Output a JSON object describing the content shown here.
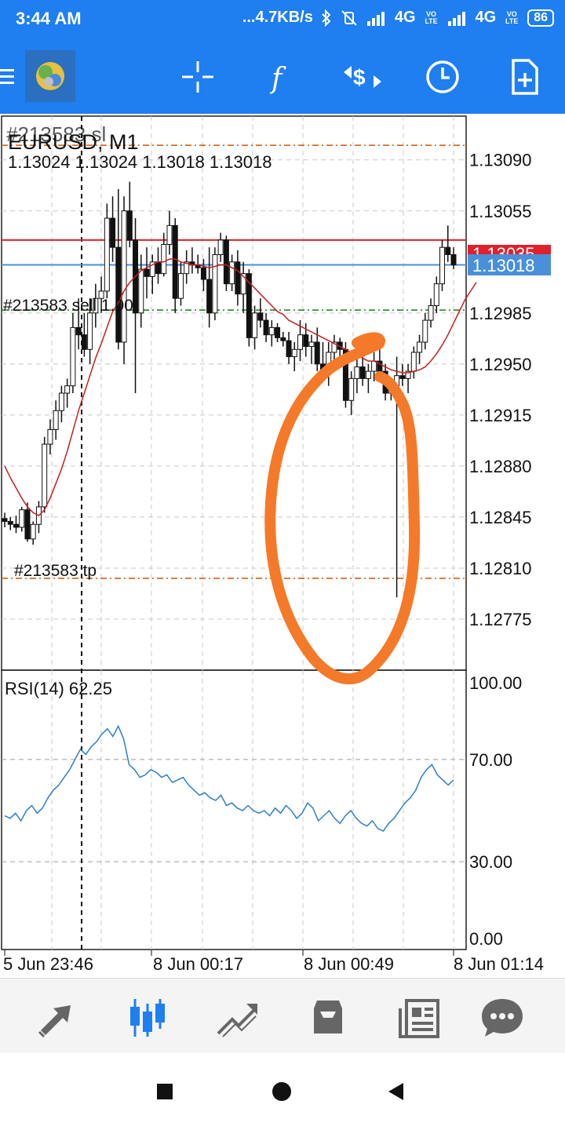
{
  "status_bar": {
    "time": "3:44 AM",
    "net_speed": "...4.7KB/s",
    "signal_1": "4G",
    "signal_2": "4G",
    "volte": "VO LTE",
    "battery": "86",
    "icons": [
      "bluetooth-icon",
      "mute-vibrate-icon",
      "signal-icon",
      "battery-icon"
    ]
  },
  "toolbar": {
    "app_icon": "metatrader-logo-icon",
    "actions": [
      "menu-icon",
      "crosshair-icon",
      "indicators-icon",
      "trade-icon",
      "timeframe-clock-icon",
      "new-order-icon"
    ],
    "indicators_glyph": "f"
  },
  "chart": {
    "symbol": "EURUSD, M1",
    "ohlc": "1.13024 1.13024 1.13018 1.13018",
    "bid": "1.13018",
    "ask": "1.13035",
    "order_sl_label": "#213583 sl",
    "order_open_label": "#213583 sell 1.00",
    "order_tp_label": "#213583 tp",
    "price_ticks": [
      "1.13090",
      "1.13055",
      "1.12985",
      "1.12950",
      "1.12915",
      "1.12880",
      "1.12845",
      "1.12810",
      "1.12775"
    ],
    "rsi_label": "RSI(14) 62.25",
    "rsi_ticks": [
      "100.00",
      "70.00",
      "30.00",
      "0.00"
    ],
    "time_labels": [
      "5 Jun 23:46",
      "8 Jun 00:17",
      "8 Jun 00:49",
      "8 Jun 01:14"
    ],
    "colors": {
      "bid_line": "#4a90d9",
      "ask_line": "#e0202a",
      "ma_line": "#c81e1e",
      "rsi_line": "#2d7fc4",
      "sl_tp_line": "#d35400",
      "open_line": "#1a7a1a",
      "annotation": "#f47a2a"
    },
    "note_annotation": "orange hand-drawn circle around long downward wick near 8 Jun 00:49"
  },
  "chart_data": {
    "type": "candlestick",
    "title": "EURUSD, M1",
    "x": [
      "5 Jun 23:46",
      "8 Jun 00:17",
      "8 Jun 00:49",
      "8 Jun 01:14"
    ],
    "ylim": [
      1.1274,
      1.1312
    ],
    "order_levels": {
      "sl": 1.131,
      "open": 1.12987,
      "tp": 1.12803
    },
    "current": {
      "bid": 1.13018,
      "ask": 1.13035
    },
    "last_bar_ohlc": [
      1.13024,
      1.13024,
      1.13018,
      1.13018
    ],
    "candles": [
      [
        1.12844,
        1.12848,
        1.12838,
        1.12842
      ],
      [
        1.12842,
        1.12845,
        1.12836,
        1.1284
      ],
      [
        1.1284,
        1.12846,
        1.12834,
        1.12838
      ],
      [
        1.12838,
        1.12852,
        1.12835,
        1.1285
      ],
      [
        1.1285,
        1.12855,
        1.12828,
        1.1283
      ],
      [
        1.1283,
        1.12842,
        1.12826,
        1.1284
      ],
      [
        1.1284,
        1.12856,
        1.12834,
        1.12852
      ],
      [
        1.12852,
        1.129,
        1.12848,
        1.12895
      ],
      [
        1.12895,
        1.12912,
        1.12888,
        1.12905
      ],
      [
        1.12905,
        1.12925,
        1.12898,
        1.12918
      ],
      [
        1.12918,
        1.12935,
        1.1291,
        1.1293
      ],
      [
        1.1293,
        1.1294,
        1.1292,
        1.12935
      ],
      [
        1.12935,
        1.12985,
        1.1293,
        1.12975
      ],
      [
        1.12975,
        1.12995,
        1.1296,
        1.1297
      ],
      [
        1.1297,
        1.12985,
        1.12955,
        1.1296
      ],
      [
        1.1296,
        1.12995,
        1.1295,
        1.12985
      ],
      [
        1.12985,
        1.13005,
        1.12975,
        1.12995
      ],
      [
        1.12995,
        1.1301,
        1.12985,
        1.13
      ],
      [
        1.13,
        1.1306,
        1.12995,
        1.1305
      ],
      [
        1.1305,
        1.13065,
        1.1302,
        1.1303
      ],
      [
        1.1303,
        1.1307,
        1.1296,
        1.12965
      ],
      [
        1.12965,
        1.13065,
        1.1295,
        1.13055
      ],
      [
        1.13055,
        1.13075,
        1.1303,
        1.13035
      ],
      [
        1.13035,
        1.1305,
        1.1293,
        1.12985
      ],
      [
        1.12985,
        1.13025,
        1.12975,
        1.13015
      ],
      [
        1.13015,
        1.1303,
        1.12995,
        1.1301
      ],
      [
        1.1301,
        1.13025,
        1.12998,
        1.1302
      ],
      [
        1.1302,
        1.1303,
        1.13005,
        1.13012
      ],
      [
        1.13012,
        1.1304,
        1.1301,
        1.13032
      ],
      [
        1.13032,
        1.13055,
        1.13025,
        1.13045
      ],
      [
        1.13045,
        1.1305,
        1.12985,
        1.12995
      ],
      [
        1.12995,
        1.1302,
        1.1299,
        1.13012
      ],
      [
        1.13012,
        1.13028,
        1.13005,
        1.1302
      ],
      [
        1.1302,
        1.1303,
        1.13012,
        1.13018
      ],
      [
        1.13018,
        1.13025,
        1.13012,
        1.13016
      ],
      [
        1.13016,
        1.13022,
        1.13,
        1.13008
      ],
      [
        1.13008,
        1.1303,
        1.12975,
        1.12985
      ],
      [
        1.12985,
        1.1303,
        1.1298,
        1.13025
      ],
      [
        1.13025,
        1.1304,
        1.1302,
        1.13035
      ],
      [
        1.13035,
        1.13038,
        1.13,
        1.13005
      ],
      [
        1.13005,
        1.13025,
        1.13,
        1.1302
      ],
      [
        1.1302,
        1.13028,
        1.1299,
        1.12998
      ],
      [
        1.12998,
        1.1302,
        1.12985,
        1.13012
      ],
      [
        1.13012,
        1.13015,
        1.12962,
        1.12968
      ],
      [
        1.12968,
        1.1299,
        1.1296,
        1.12985
      ],
      [
        1.12985,
        1.12995,
        1.12975,
        1.1298
      ],
      [
        1.1298,
        1.12985,
        1.12965,
        1.1297
      ],
      [
        1.1297,
        1.1298,
        1.12962,
        1.12975
      ],
      [
        1.12975,
        1.12978,
        1.12965,
        1.12968
      ],
      [
        1.12968,
        1.12972,
        1.12962,
        1.12966
      ],
      [
        1.12966,
        1.12972,
        1.1295,
        1.12955
      ],
      [
        1.12955,
        1.12965,
        1.12945,
        1.1296
      ],
      [
        1.1296,
        1.1298,
        1.12952,
        1.1297
      ],
      [
        1.1297,
        1.12978,
        1.12955,
        1.12962
      ],
      [
        1.12962,
        1.1297,
        1.1295,
        1.12965
      ],
      [
        1.12965,
        1.12975,
        1.12945,
        1.1295
      ],
      [
        1.1295,
        1.12965,
        1.1294,
        1.12945
      ],
      [
        1.12945,
        1.12965,
        1.12935,
        1.12958
      ],
      [
        1.12958,
        1.1297,
        1.1295,
        1.12965
      ],
      [
        1.12965,
        1.12968,
        1.12955,
        1.1296
      ],
      [
        1.1296,
        1.12965,
        1.1292,
        1.12925
      ],
      [
        1.12925,
        1.12945,
        1.12915,
        1.1294
      ],
      [
        1.1294,
        1.12955,
        1.1293,
        1.12948
      ],
      [
        1.12948,
        1.12955,
        1.12935,
        1.1294
      ],
      [
        1.1294,
        1.1295,
        1.1293,
        1.12945
      ],
      [
        1.12945,
        1.12958,
        1.12938,
        1.12952
      ],
      [
        1.12952,
        1.1296,
        1.1294,
        1.12945
      ],
      [
        1.12945,
        1.1295,
        1.12925,
        1.1293
      ],
      [
        1.1293,
        1.1294,
        1.12925,
        1.12935
      ],
      [
        1.12935,
        1.12955,
        1.1279,
        1.12942
      ],
      [
        1.12942,
        1.1295,
        1.12935,
        1.1294
      ],
      [
        1.1294,
        1.1295,
        1.1293,
        1.12945
      ],
      [
        1.12945,
        1.12962,
        1.1294,
        1.12958
      ],
      [
        1.12958,
        1.1297,
        1.1295,
        1.12965
      ],
      [
        1.12965,
        1.12985,
        1.1296,
        1.1298
      ],
      [
        1.1298,
        1.12995,
        1.12975,
        1.1299
      ],
      [
        1.1299,
        1.1301,
        1.12985,
        1.13005
      ],
      [
        1.13005,
        1.13035,
        1.13,
        1.1303
      ],
      [
        1.1303,
        1.13045,
        1.1302,
        1.13025
      ],
      [
        1.13025,
        1.1303,
        1.13015,
        1.13018
      ]
    ],
    "rsi": [
      48,
      47,
      49,
      46,
      50,
      52,
      49,
      51,
      55,
      58,
      60,
      63,
      66,
      70,
      74,
      72,
      75,
      77,
      80,
      82,
      79,
      83,
      78,
      68,
      66,
      63,
      64,
      66,
      65,
      63,
      64,
      61,
      62,
      63,
      60,
      58,
      56,
      57,
      55,
      54,
      56,
      52,
      53,
      51,
      50,
      52,
      50,
      49,
      50,
      48,
      51,
      49,
      52,
      50,
      47,
      49,
      53,
      51,
      46,
      48,
      50,
      47,
      45,
      48,
      50,
      47,
      45,
      44,
      46,
      43,
      42,
      45,
      47,
      50,
      53,
      55,
      58,
      63,
      66,
      68,
      64,
      62,
      60,
      62
    ],
    "rsi_ylim": [
      0,
      100
    ],
    "rsi_levels": [
      70,
      30
    ],
    "ma": [
      1.1288,
      1.12872,
      1.12865,
      1.12858,
      1.12852,
      1.12848,
      1.12846,
      1.1285,
      1.12858,
      1.12868,
      1.12878,
      1.1289,
      1.12904,
      1.12918,
      1.1293,
      1.12942,
      1.12954,
      1.12964,
      1.12975,
      1.12986,
      1.12992,
      1.13,
      1.13006,
      1.1301,
      1.13014,
      1.13016,
      1.13018,
      1.1302,
      1.1302,
      1.13022,
      1.13022,
      1.1302,
      1.13019,
      1.13018,
      1.13018,
      1.13017,
      1.13016,
      1.13017,
      1.13018,
      1.13018,
      1.13016,
      1.13014,
      1.1301,
      1.13006,
      1.13002,
      1.12998,
      1.12994,
      1.1299,
      1.12986,
      1.12984,
      1.1298,
      1.12978,
      1.12976,
      1.12974,
      1.12972,
      1.1297,
      1.12968,
      1.12966,
      1.12964,
      1.12962,
      1.1296,
      1.12958,
      1.12956,
      1.12954,
      1.12952,
      1.12952,
      1.1295,
      1.12948,
      1.12946,
      1.12945,
      1.12944,
      1.12944,
      1.12945,
      1.12946,
      1.12948,
      1.12952,
      1.12957,
      1.12963,
      1.1297,
      1.12978,
      1.12986,
      1.12994,
      1.13,
      1.13006
    ]
  },
  "bottom_nav": {
    "items": [
      "quotes-icon",
      "chart-icon",
      "trade-icon",
      "history-icon",
      "news-icon",
      "messages-icon"
    ],
    "active_color": "#1f7ef0",
    "inactive_color": "#666666"
  },
  "system_nav": {
    "items": [
      "recent-apps-icon",
      "home-icon",
      "back-icon"
    ]
  }
}
